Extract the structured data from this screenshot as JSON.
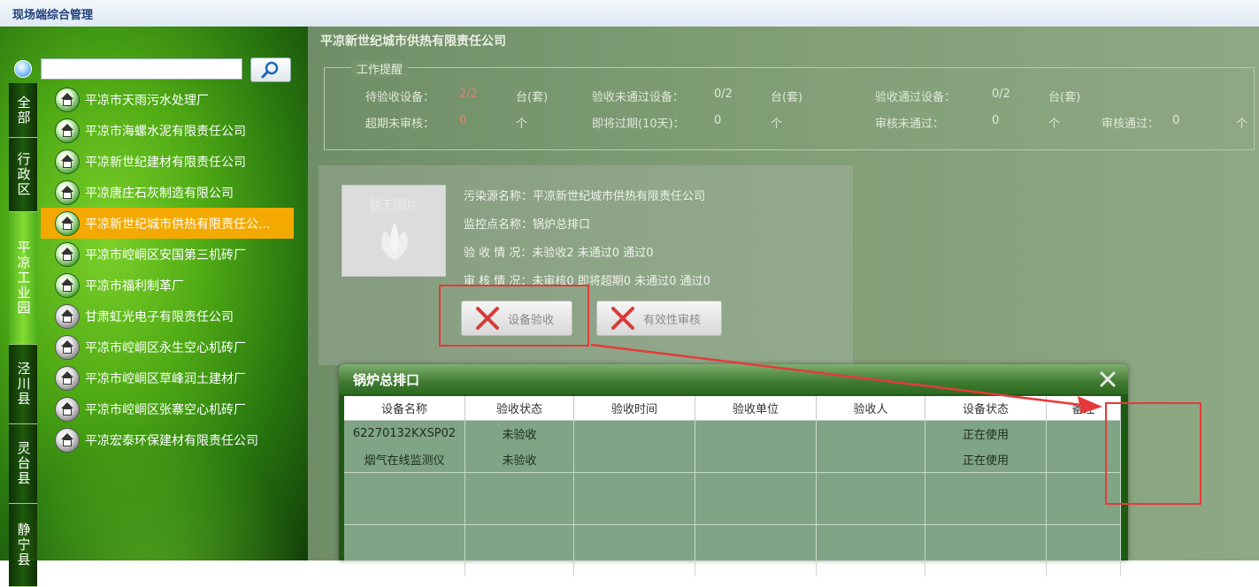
{
  "app": {
    "title": "现场端综合管理"
  },
  "sidebar": {
    "search": {
      "value": "",
      "placeholder": ""
    },
    "region_tabs": [
      {
        "label": "全部"
      },
      {
        "label": "行政区"
      },
      {
        "label": "平凉工业园"
      },
      {
        "label": "泾川县"
      },
      {
        "label": "灵台县"
      },
      {
        "label": "静宁县"
      }
    ],
    "active_region": "平凉工业园",
    "companies": [
      {
        "name": "平凉市天雨污水处理厂",
        "icon": "green-house-icon"
      },
      {
        "name": "平凉市海螺水泥有限责任公司",
        "icon": "green-house-icon"
      },
      {
        "name": "平凉新世纪建材有限责任公司",
        "icon": "green-house-icon"
      },
      {
        "name": "平凉唐庄石灰制造有限公司",
        "icon": "green-house-icon"
      },
      {
        "name": "平凉新世纪城市供热有限责任公...",
        "icon": "green-house-icon",
        "selected": true
      },
      {
        "name": "平凉市崆峒区安国第三机砖厂",
        "icon": "green-house-icon"
      },
      {
        "name": "平凉市福利制革厂",
        "icon": "green-house-icon"
      },
      {
        "name": "甘肃虹光电子有限责任公司",
        "icon": "gray-house-icon"
      },
      {
        "name": "平凉市崆峒区永生空心机砖厂",
        "icon": "gray-house-icon"
      },
      {
        "name": "平凉市崆峒区草峰润土建材厂",
        "icon": "gray-house-icon"
      },
      {
        "name": "平凉市崆峒区张寨空心机砖厂",
        "icon": "gray-house-icon"
      },
      {
        "name": "平凉宏泰环保建材有限责任公司",
        "icon": "gray-house-icon"
      }
    ]
  },
  "main": {
    "company_title": "平凉新世纪城市供热有限责任公司",
    "reminder": {
      "legend": "工作提醒",
      "pending_label": "待验收设备：",
      "pending_value": "2/2",
      "pending_unit": "台(套)",
      "failed_label": "验收未通过设备：",
      "failed_value": "0/2",
      "failed_unit": "台(套)",
      "passed_label": "验收通过设备：",
      "passed_value": "0/2",
      "passed_unit": "台(套)",
      "overdue_label": "超期未审核：",
      "overdue_value": "0",
      "overdue_unit": "个",
      "expiring_label": "即将过期(10天)：",
      "expiring_value": "0",
      "expiring_unit": "个",
      "review_fail_label": "审核未通过：",
      "review_fail_value": "0",
      "review_fail_unit": "个",
      "review_pass_label": "审核通过：",
      "review_pass_value": "0",
      "review_pass_unit": "个"
    },
    "station": {
      "photo_placeholder": "暂无图片",
      "source_label": "污染源名称：",
      "source_value": "平凉新世纪城市供热有限责任公司",
      "point_label": "监控点名称：",
      "point_value": "锅炉总排口",
      "acceptance_label": "验 收 情 况：",
      "acceptance_value": "未验收2 未通过0 通过0",
      "review_label": "审 核 情 况：",
      "review_value": "未审核0 即将超期0 未通过0 通过0",
      "btn_acceptance": "设备验收",
      "btn_review": "有效性审核"
    }
  },
  "dialog": {
    "title": "锅炉总排口",
    "columns": [
      "设备名称",
      "验收状态",
      "验收时间",
      "验收单位",
      "验收人",
      "设备状态",
      "备注"
    ],
    "rows": [
      [
        "62270132KXSP02",
        "未验收",
        "",
        "",
        "",
        "正在使用",
        ""
      ],
      [
        "烟气在线监测仪",
        "未验收",
        "",
        "",
        "",
        "正在使用",
        ""
      ]
    ]
  },
  "colors": {
    "accent_orange": "#f4a900",
    "annotation_red": "#e53a3a",
    "dialog_green": "#2c6a20"
  }
}
